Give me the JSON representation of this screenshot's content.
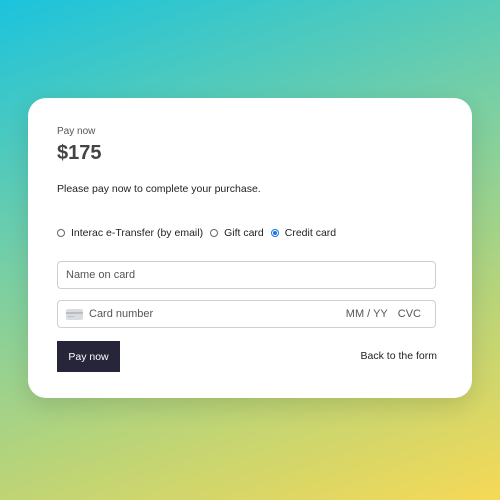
{
  "payment": {
    "eyebrow": "Pay now",
    "amount": "$175",
    "description": "Please pay now to complete your purchase.",
    "methods": [
      {
        "label": "Interac e-Transfer (by email)",
        "selected": false
      },
      {
        "label": "Gift card",
        "selected": false
      },
      {
        "label": "Credit card",
        "selected": true
      }
    ],
    "name_placeholder": "Name on card",
    "card_placeholder": "Card number",
    "expiry_placeholder": "MM / YY",
    "cvc_placeholder": "CVC",
    "pay_button": "Pay now",
    "back_link": "Back to the form"
  },
  "colors": {
    "button_bg": "#27253a",
    "radio_accent": "#1a73e8"
  }
}
